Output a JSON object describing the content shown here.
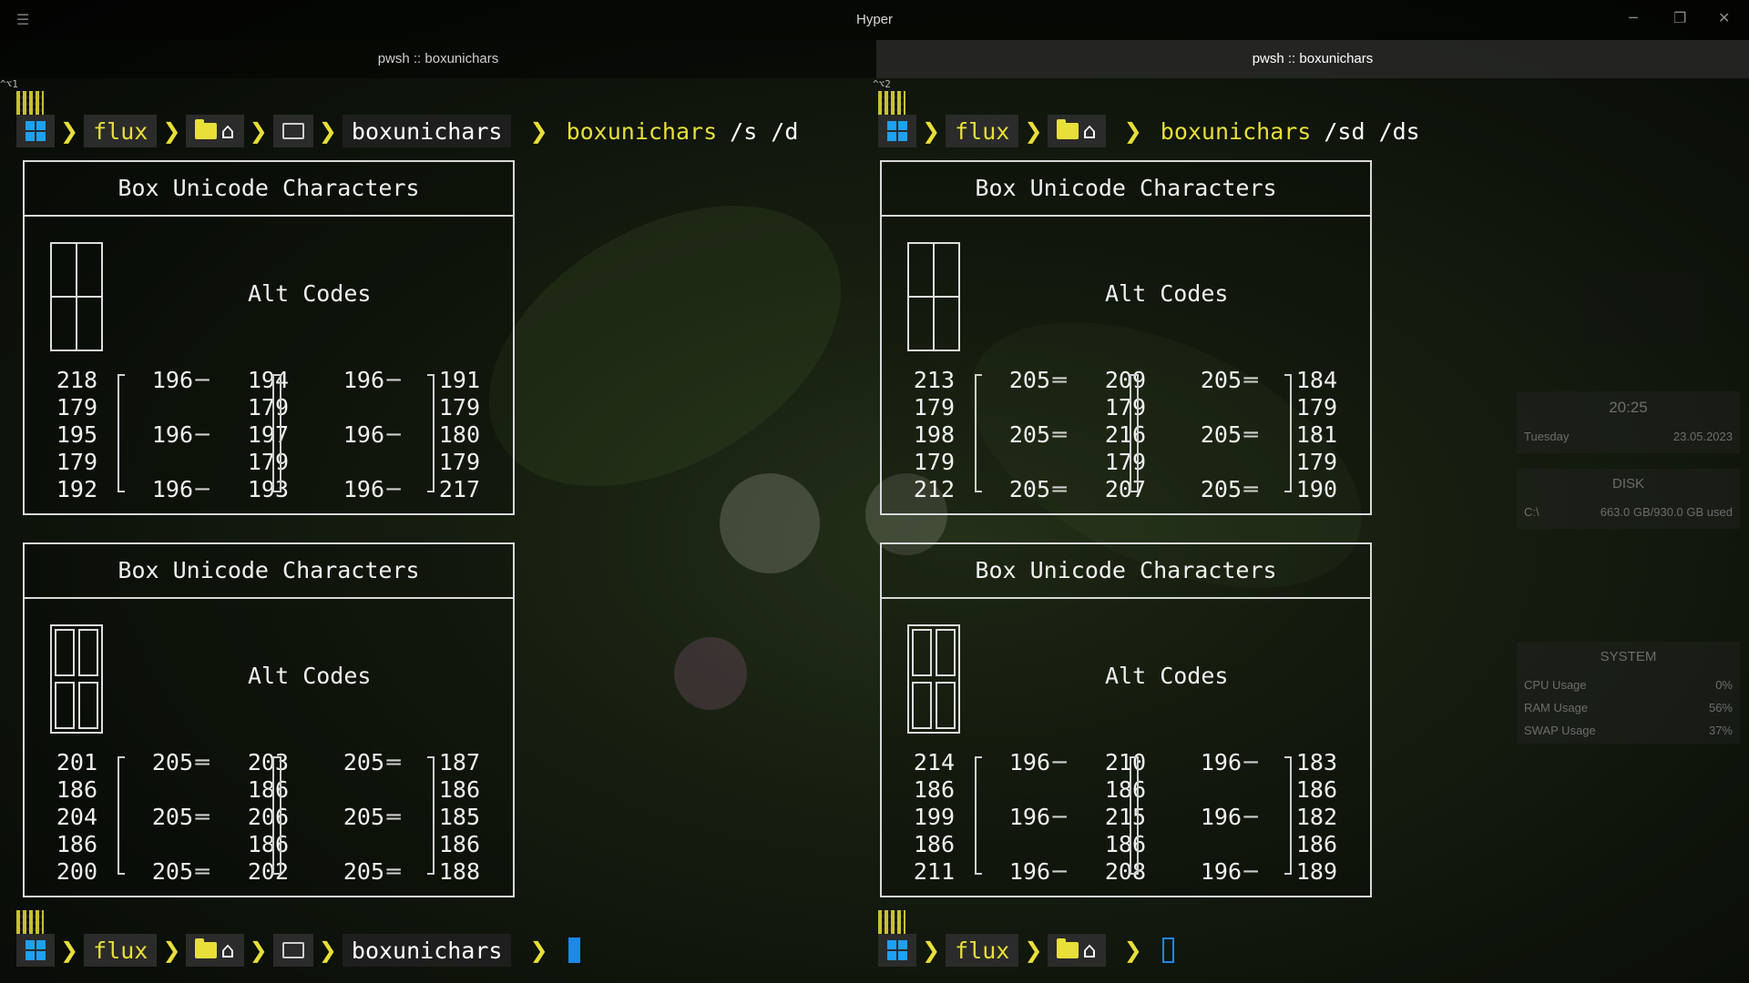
{
  "window": {
    "title": "Hyper",
    "menu_icon": "hamburger-icon",
    "controls": [
      "minimize-icon",
      "restore-icon",
      "close-icon"
    ]
  },
  "tabs": [
    {
      "label": "pwsh :: boxunichars",
      "active": false
    },
    {
      "label": "pwsh :: boxunichars",
      "active": true
    }
  ],
  "panes": [
    {
      "label": "^⌥1",
      "prompt_top": {
        "user": "flux",
        "dir": "boxunichars",
        "command": "boxunichars",
        "args": "/s /d"
      },
      "prompt_bottom": {
        "user": "flux",
        "dir": "boxunichars"
      },
      "boxes": [
        {
          "title": "Box Unicode Characters",
          "alt_label": "Alt Codes",
          "rows": [
            [
              "218",
              "196",
              "─",
              "194",
              "196",
              "─",
              "191"
            ],
            [
              "179",
              "",
              "",
              "179",
              "",
              "",
              "179"
            ],
            [
              "195",
              "196",
              "─",
              "197",
              "196",
              "─",
              "180"
            ],
            [
              "179",
              "",
              "",
              "179",
              "",
              "",
              "179"
            ],
            [
              "192",
              "196",
              "─",
              "193",
              "196",
              "─",
              "217"
            ]
          ]
        },
        {
          "title": "Box Unicode Characters",
          "alt_label": "Alt Codes",
          "rows": [
            [
              "201",
              "205",
              "═",
              "203",
              "205",
              "═",
              "187"
            ],
            [
              "186",
              "",
              "",
              "186",
              "",
              "",
              "186"
            ],
            [
              "204",
              "205",
              "═",
              "206",
              "205",
              "═",
              "185"
            ],
            [
              "186",
              "",
              "",
              "186",
              "",
              "",
              "186"
            ],
            [
              "200",
              "205",
              "═",
              "202",
              "205",
              "═",
              "188"
            ]
          ]
        }
      ]
    },
    {
      "label": "^⌥2",
      "prompt_top": {
        "user": "flux",
        "command": "boxunichars",
        "args": "/sd /ds"
      },
      "prompt_bottom": {
        "user": "flux"
      },
      "boxes": [
        {
          "title": "Box Unicode Characters",
          "alt_label": "Alt Codes",
          "rows": [
            [
              "213",
              "205",
              "═",
              "209",
              "205",
              "═",
              "184"
            ],
            [
              "179",
              "",
              "",
              "179",
              "",
              "",
              "179"
            ],
            [
              "198",
              "205",
              "═",
              "216",
              "205",
              "═",
              "181"
            ],
            [
              "179",
              "",
              "",
              "179",
              "",
              "",
              "179"
            ],
            [
              "212",
              "205",
              "═",
              "207",
              "205",
              "═",
              "190"
            ]
          ]
        },
        {
          "title": "Box Unicode Characters",
          "alt_label": "Alt Codes",
          "rows": [
            [
              "214",
              "196",
              "─",
              "210",
              "196",
              "─",
              "183"
            ],
            [
              "186",
              "",
              "",
              "186",
              "",
              "",
              "186"
            ],
            [
              "199",
              "196",
              "─",
              "215",
              "196",
              "─",
              "182"
            ],
            [
              "186",
              "",
              "",
              "186",
              "",
              "",
              "186"
            ],
            [
              "211",
              "196",
              "─",
              "208",
              "196",
              "─",
              "189"
            ]
          ]
        }
      ]
    }
  ],
  "widgets": {
    "clock": {
      "time": "20:25",
      "day": "Tuesday",
      "date": "23.05.2023"
    },
    "disk": {
      "title": "DISK",
      "drive": "C:\\",
      "usage": "663.0 GB/930.0 GB used"
    },
    "system": {
      "title": "SYSTEM",
      "rows": [
        {
          "label": "CPU Usage",
          "value": "0%"
        },
        {
          "label": "RAM Usage",
          "value": "56%"
        },
        {
          "label": "SWAP Usage",
          "value": "37%"
        }
      ]
    }
  },
  "colors": {
    "accent": "#e8df3a",
    "cursor": "#1e88e5",
    "windows_logo": "#1da1f2"
  }
}
